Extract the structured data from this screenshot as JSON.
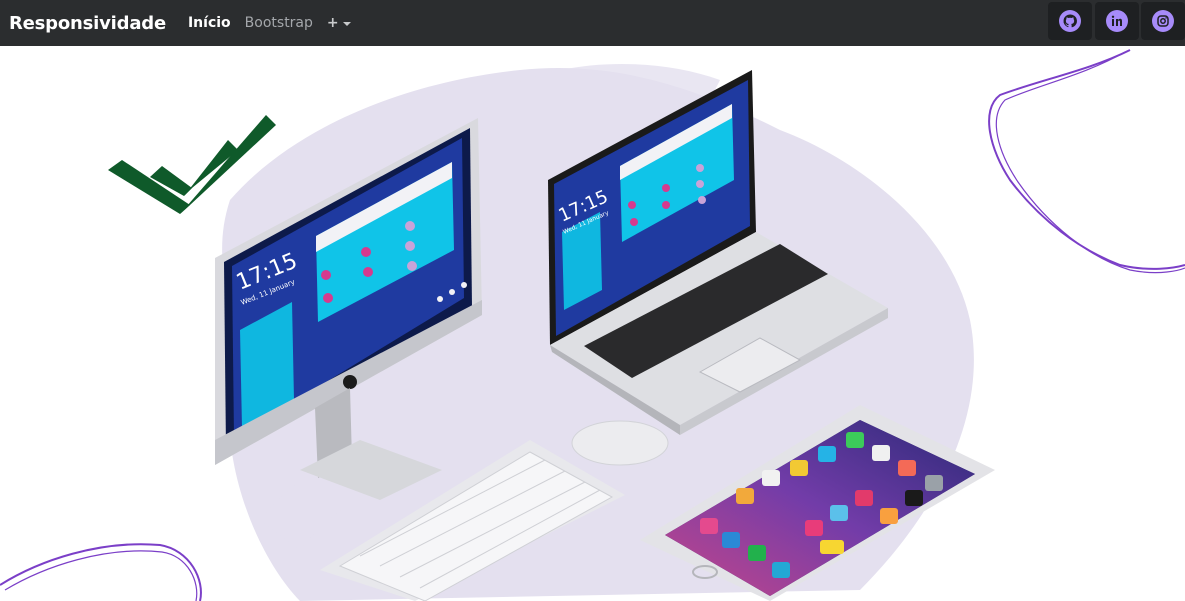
{
  "navbar": {
    "brand": "Responsividade",
    "links": [
      {
        "label": "Início",
        "active": true
      },
      {
        "label": "Bootstrap",
        "active": false
      }
    ],
    "dropdown_label": "+"
  },
  "social": [
    {
      "icon": "github-icon"
    },
    {
      "icon": "linkedin-icon"
    },
    {
      "icon": "instagram-icon"
    }
  ],
  "hero": {
    "monitor_time": "17:15",
    "monitor_date": "Wed, 11 January",
    "laptop_time": "17:15",
    "laptop_date": "Wed, 11 January"
  },
  "colors": {
    "navbar_bg": "#2b2d2f",
    "accent_purple": "#a78bfa",
    "checkmark_green": "#0f5a2a"
  }
}
